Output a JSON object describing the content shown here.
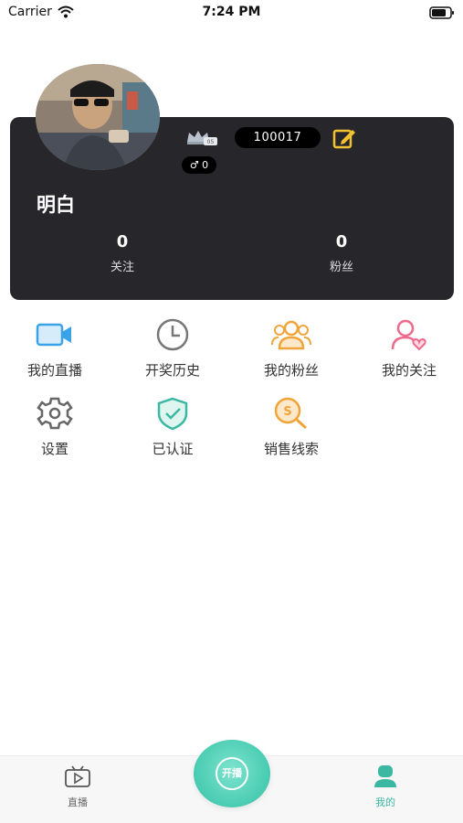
{
  "status_bar": {
    "carrier": "Carrier",
    "time": "7:24 PM"
  },
  "profile": {
    "user_id": "100017",
    "gender_count": "♂ 0",
    "username": "明白",
    "stats": [
      {
        "value": "0",
        "label": "关注"
      },
      {
        "value": "0",
        "label": "粉丝"
      }
    ],
    "vip_level": "05"
  },
  "menu": {
    "items": [
      {
        "label": "我的直播",
        "icon": "video-camera-icon",
        "color": "#3aa3e8"
      },
      {
        "label": "开奖历史",
        "icon": "clock-icon",
        "color": "#777777"
      },
      {
        "label": "我的粉丝",
        "icon": "group-icon",
        "color": "#f0a53a"
      },
      {
        "label": "我的关注",
        "icon": "person-heart-icon",
        "color": "#ee6a8c"
      },
      {
        "label": "设置",
        "icon": "gear-icon",
        "color": "#666666"
      },
      {
        "label": "已认证",
        "icon": "shield-check-icon",
        "color": "#3bb8a2"
      },
      {
        "label": "销售线索",
        "icon": "money-search-icon",
        "color": "#f0a53a"
      }
    ]
  },
  "tab_bar": {
    "live_label": "直播",
    "go_live_label": "开播",
    "mine_label": "我的",
    "accent": "#3bb8a2"
  }
}
